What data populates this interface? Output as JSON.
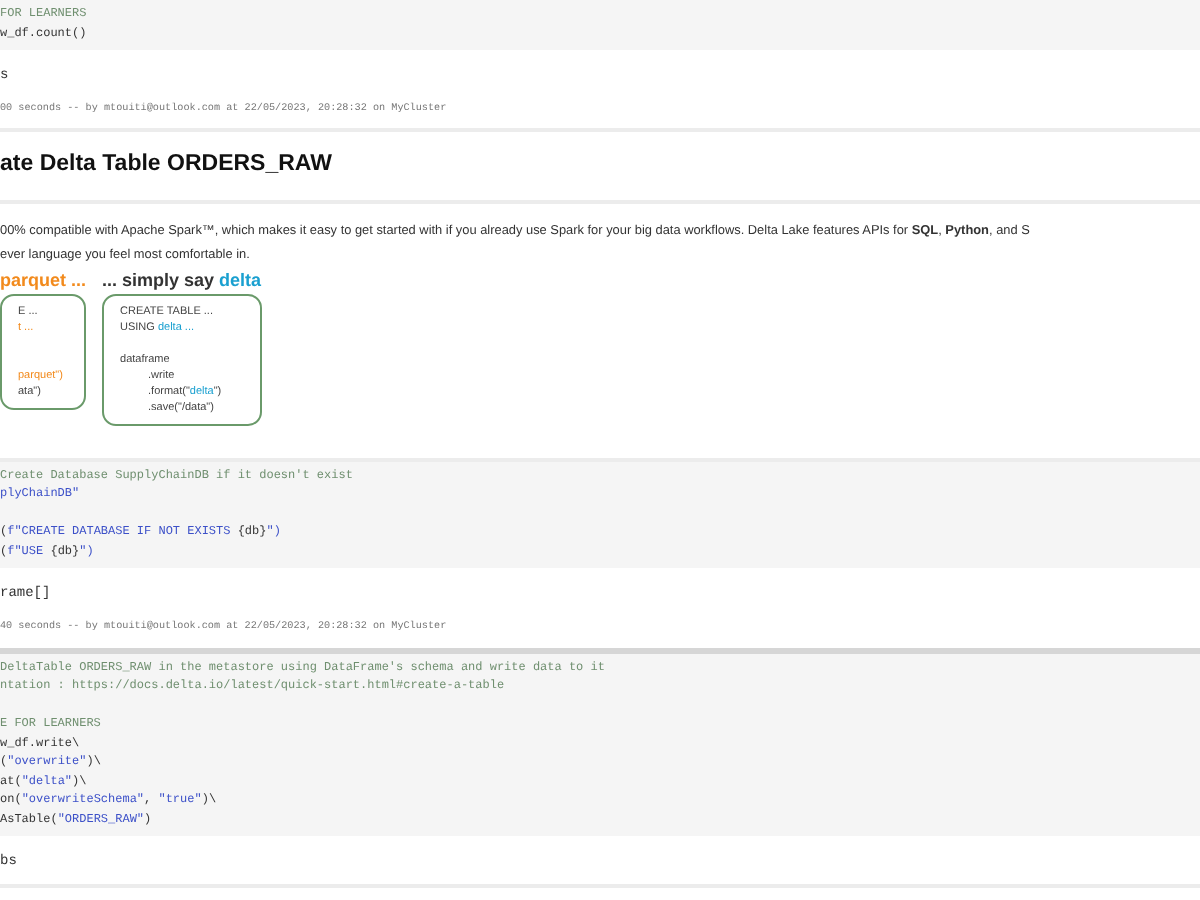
{
  "cells": [
    {
      "kind": "code",
      "code": [
        {
          "kind": "code",
          "segments": [
            {
              "t": "FOR LEARNERS",
              "kind": "comment"
            }
          ]
        },
        {
          "kind": "code",
          "segments": [
            {
              "t": "w_df.count()",
              "kind": "plain"
            }
          ]
        }
      ],
      "output": [
        "s"
      ],
      "footer": "00 seconds -- by mtouiti@outlook.com at 22/05/2023, 20:28:32 on MyCluster"
    },
    {
      "kind": "heading",
      "text": "ate Delta Table ORDERS_RAW"
    },
    {
      "kind": "markdown",
      "lines": [
        "00% compatible with Apache Spark™, which makes it easy to get started with if you already use Spark for your big data workflows. Delta Lake features APIs for **SQL**, **Python**, and S",
        "ever language you feel most comfortable in."
      ],
      "panels": [
        {
          "kind": "parquet",
          "header": [
            {
              "t": "parquet ...",
              "kind": "hl"
            }
          ],
          "lines": [
            {
              "kind": "code",
              "segments": [
                {
                  "t": "E ...",
                  "kind": "plain"
                }
              ]
            },
            {
              "kind": "code",
              "segments": [
                {
                  "t": "t ...",
                  "kind": "hl"
                }
              ]
            },
            {
              "kind": "blank"
            },
            {
              "kind": "blank"
            },
            {
              "kind": "code",
              "segments": [
                {
                  "t": "parquet\")",
                  "kind": "hl"
                }
              ]
            },
            {
              "kind": "code",
              "segments": [
                {
                  "t": "ata\")",
                  "kind": "plain"
                }
              ]
            }
          ]
        },
        {
          "kind": "delta",
          "header": [
            {
              "t": "... simply say ",
              "kind": "plain"
            },
            {
              "t": "delta",
              "kind": "hl"
            }
          ],
          "lines": [
            {
              "kind": "code",
              "indented": false,
              "segments": [
                {
                  "t": "CREATE TABLE ...",
                  "kind": "plain"
                }
              ]
            },
            {
              "kind": "code",
              "indented": false,
              "segments": [
                {
                  "t": "USING ",
                  "kind": "plain"
                },
                {
                  "t": "delta ...",
                  "kind": "hl"
                }
              ]
            },
            {
              "kind": "blank"
            },
            {
              "kind": "code",
              "indented": false,
              "segments": [
                {
                  "t": "dataframe",
                  "kind": "plain"
                }
              ]
            },
            {
              "kind": "code",
              "indented": true,
              "segments": [
                {
                  "t": ".write",
                  "kind": "plain"
                }
              ]
            },
            {
              "kind": "code",
              "indented": true,
              "segments": [
                {
                  "t": ".format(\"",
                  "kind": "plain"
                },
                {
                  "t": "delta",
                  "kind": "hl"
                },
                {
                  "t": "\")",
                  "kind": "plain"
                }
              ]
            },
            {
              "kind": "code",
              "indented": true,
              "segments": [
                {
                  "t": ".save(\"/data\")",
                  "kind": "plain"
                }
              ]
            }
          ]
        }
      ]
    },
    {
      "kind": "code",
      "code": [
        {
          "kind": "code",
          "segments": [
            {
              "t": "Create Database SupplyChainDB if it doesn't exist",
              "kind": "comment"
            }
          ]
        },
        {
          "kind": "code",
          "segments": [
            {
              "t": "plyChainDB\"",
              "kind": "string"
            }
          ]
        },
        {
          "kind": "blank"
        },
        {
          "kind": "code",
          "segments": [
            {
              "t": "(",
              "kind": "plain"
            },
            {
              "t": "f\"CREATE DATABASE IF NOT EXISTS ",
              "kind": "string"
            },
            {
              "t": "{db}",
              "kind": "plain"
            },
            {
              "t": "\")",
              "kind": "string"
            }
          ]
        },
        {
          "kind": "code",
          "segments": [
            {
              "t": "(",
              "kind": "plain"
            },
            {
              "t": "f\"USE ",
              "kind": "string"
            },
            {
              "t": "{db}",
              "kind": "plain"
            },
            {
              "t": "\")",
              "kind": "string"
            }
          ]
        }
      ],
      "output": [
        "rame[]"
      ],
      "footer": "40 seconds -- by mtouiti@outlook.com at 22/05/2023, 20:28:32 on MyCluster"
    },
    {
      "kind": "code",
      "code": [
        {
          "kind": "code",
          "segments": [
            {
              "t": "DeltaTable ORDERS_RAW in the metastore using DataFrame's schema and write data to it",
              "kind": "comment"
            }
          ]
        },
        {
          "kind": "code",
          "segments": [
            {
              "t": "ntation : https://docs.delta.io/latest/quick-start.html#create-a-table",
              "kind": "comment"
            }
          ]
        },
        {
          "kind": "blank"
        },
        {
          "kind": "code",
          "segments": [
            {
              "t": "E FOR LEARNERS",
              "kind": "comment"
            }
          ]
        },
        {
          "kind": "code",
          "segments": [
            {
              "t": "w_df.write\\",
              "kind": "plain"
            }
          ]
        },
        {
          "kind": "code",
          "segments": [
            {
              "t": "(",
              "kind": "plain"
            },
            {
              "t": "\"overwrite\"",
              "kind": "string"
            },
            {
              "t": ")\\",
              "kind": "plain"
            }
          ]
        },
        {
          "kind": "code",
          "segments": [
            {
              "t": "at(",
              "kind": "plain"
            },
            {
              "t": "\"delta\"",
              "kind": "string"
            },
            {
              "t": ")\\",
              "kind": "plain"
            }
          ]
        },
        {
          "kind": "code",
          "segments": [
            {
              "t": "on(",
              "kind": "plain"
            },
            {
              "t": "\"overwriteSchema\"",
              "kind": "string"
            },
            {
              "t": ", ",
              "kind": "plain"
            },
            {
              "t": "\"true\"",
              "kind": "string"
            },
            {
              "t": ")\\",
              "kind": "plain"
            }
          ]
        },
        {
          "kind": "code",
          "segments": [
            {
              "t": "AsTable(",
              "kind": "plain"
            },
            {
              "t": "\"ORDERS_RAW\"",
              "kind": "string"
            },
            {
              "t": ")",
              "kind": "plain"
            }
          ]
        }
      ],
      "output": [
        "bs"
      ]
    }
  ]
}
